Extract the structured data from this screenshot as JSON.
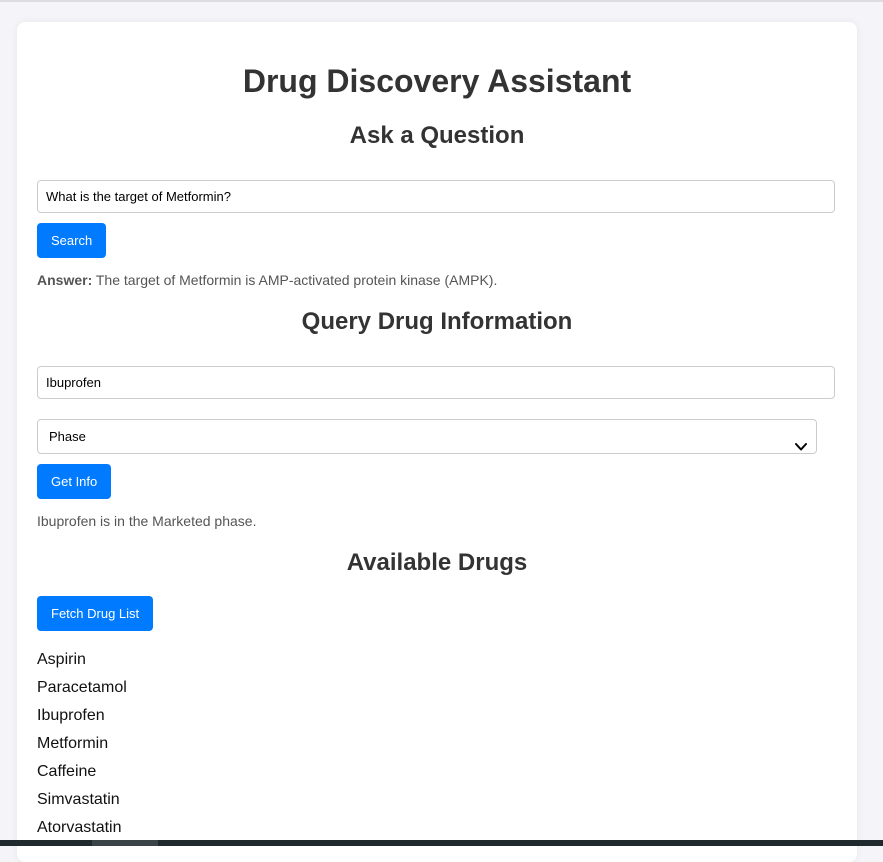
{
  "app": {
    "title": "Drug Discovery Assistant"
  },
  "ask": {
    "heading": "Ask a Question",
    "input_value": "What is the target of Metformin?",
    "search_label": "Search",
    "answer_label": "Answer:",
    "answer_text": "The target of Metformin is AMP-activated protein kinase (AMPK)."
  },
  "query": {
    "heading": "Query Drug Information",
    "drug_value": "Ibuprofen",
    "select_value": "Phase",
    "get_info_label": "Get Info",
    "result_text": "Ibuprofen is in the Marketed phase."
  },
  "drugs": {
    "heading": "Available Drugs",
    "fetch_label": "Fetch Drug List",
    "items": [
      "Aspirin",
      "Paracetamol",
      "Ibuprofen",
      "Metformin",
      "Caffeine",
      "Simvastatin",
      "Atorvastatin"
    ]
  },
  "colors": {
    "accent": "#007bff",
    "background": "#f4f4f9",
    "card": "#ffffff",
    "text": "#333333"
  },
  "icons": {
    "select_chevron": "chevron-down-icon"
  }
}
